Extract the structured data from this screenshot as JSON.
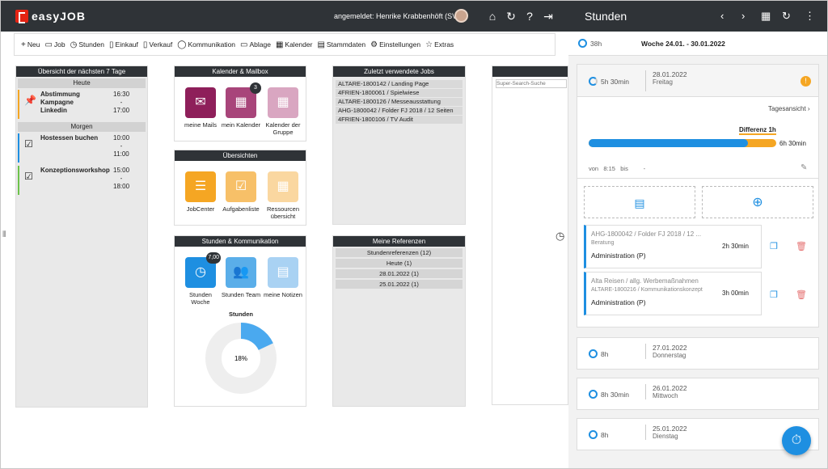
{
  "app": {
    "logo": "easyJOB",
    "user": "angemeldet: Henrike Krabbenhöft (SV)"
  },
  "toolbar": {
    "items": [
      "Neu",
      "Job",
      "Stunden",
      "Einkauf",
      "Verkauf",
      "Kommunikation",
      "Ablage",
      "Kalender",
      "Stammdaten",
      "Einstellungen",
      "Extras"
    ]
  },
  "overview": {
    "title": "Übersicht der nächsten 7 Tage",
    "today": "Heute",
    "tomorrow": "Morgen",
    "events": [
      {
        "title": "Abstimmung Kampagne Linkedin",
        "from": "16:30",
        "to": "17:00",
        "color": "#f4a623"
      },
      {
        "title": "Hostessen buchen",
        "from": "10:00",
        "to": "11:00",
        "color": "#1e8fe1"
      },
      {
        "title": "Konzeptionsworkshop",
        "from": "15:00",
        "to": "18:00",
        "color": "#6cc24a"
      }
    ]
  },
  "calendar": {
    "title": "Kalender & Mailbox",
    "tiles": [
      {
        "label": "meine Mails"
      },
      {
        "label": "mein Kalender",
        "badge": "3"
      },
      {
        "label": "Kalender der Gruppe"
      }
    ]
  },
  "overviews": {
    "title": "Übersichten",
    "tiles": [
      {
        "label": "JobCenter"
      },
      {
        "label": "Aufgabenliste"
      },
      {
        "label": "Ressourcen übersicht"
      }
    ]
  },
  "hours": {
    "title": "Stunden & Kommunikation",
    "tiles": [
      {
        "label": "Stunden Woche",
        "badge": "7,00"
      },
      {
        "label": "Stunden Team"
      },
      {
        "label": "meine Notizen"
      }
    ],
    "chart_label": "Stunden",
    "percent": "18%"
  },
  "chart_data": {
    "type": "pie",
    "values": [
      18,
      82
    ],
    "title": "Stunden"
  },
  "recent": {
    "title": "Zuletzt verwendete Jobs",
    "items": [
      "ALTARE-1800142 / Landing Page",
      "4FRIEN-1800061 / Spielwiese",
      "ALTARE-1800126 / Messeausstattung",
      "AHG-1800042 / Folder FJ 2018 / 12 Seiten",
      "4FRIEN-1800106 / TV Audit"
    ]
  },
  "refs": {
    "title": "Meine Referenzen",
    "items": [
      "Stundenreferenzen (12)",
      "Heute (1)",
      "28.01.2022 (1)",
      "25.01.2022 (1)"
    ]
  },
  "search": {
    "placeholder": "Super-Search-Suche"
  },
  "right": {
    "title": "Stunden",
    "week_hours": "38h",
    "week": "Woche 24.01. - 30.01.2022",
    "day": {
      "hours": "5h 30min",
      "date": "28.01.2022",
      "weekday": "Freitag",
      "link": "Tagesansicht",
      "diff": "Differenz 1h",
      "total": "6h 30min",
      "von": "von",
      "from": "8:15",
      "bis": "bis",
      "to": "-"
    },
    "jobs": [
      {
        "title": "AHG-1800042 / Folder FJ 2018 / 12 ...",
        "sub": "Beratung",
        "act": "Administration (P)",
        "time": "2h 30min"
      },
      {
        "title": "Alta Reisen / allg. Werbemaßnahmen",
        "sub": "ALTARE-1800216 / Kommunikationskonzept",
        "act": "Administration (P)",
        "time": "3h 00min"
      }
    ],
    "days": [
      {
        "hours": "8h",
        "date": "27.01.2022",
        "weekday": "Donnerstag"
      },
      {
        "hours": "8h 30min",
        "date": "26.01.2022",
        "weekday": "Mittwoch"
      },
      {
        "hours": "8h",
        "date": "25.01.2022",
        "weekday": "Dienstag"
      }
    ]
  }
}
